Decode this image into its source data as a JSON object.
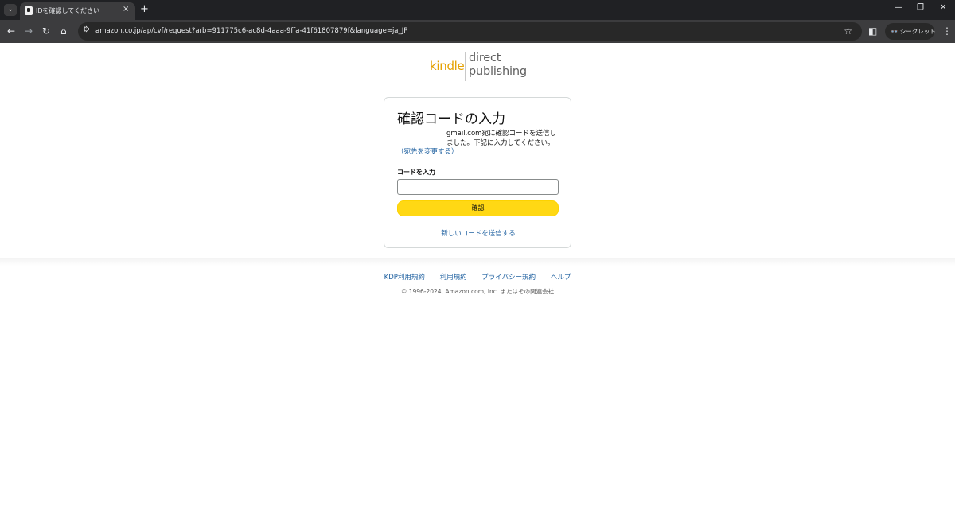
{
  "browser": {
    "tab_title": "IDを確認してください",
    "tab_close": "×",
    "new_tab": "+",
    "url": "amazon.co.jp/ap/cvf/request?arb=911775c6-ac8d-4aaa-9ffa-41f61807879f&language=ja_JP",
    "incognito_label": "シークレット",
    "icons": [
      "back-icon",
      "forward-icon",
      "reload-icon",
      "home-icon",
      "site-info-icon",
      "bookmark-star-icon",
      "side-panel-icon",
      "incognito-icon",
      "menu-icon"
    ]
  },
  "logo": {
    "kindle": "kindle",
    "direct": "direct",
    "publishing": "publishing"
  },
  "verify": {
    "title": "確認コードの入力",
    "desc_email_suffix": "gmail.com宛に確認コードを送信しました。下記に入力してください。",
    "change_link": "（宛先を変更する）",
    "code_label": "コードを入力",
    "code_value": "",
    "confirm_button": "確認",
    "resend_link": "新しいコードを送信する"
  },
  "footer": {
    "links": [
      "KDP利用規約",
      "利用規約",
      "プライバシー規約",
      "ヘルプ"
    ],
    "copyright": "© 1996-2024, Amazon.com, Inc. またはその関連会社"
  },
  "colors": {
    "kindle_orange": "#e5a100",
    "link_blue": "#2162a1",
    "button_yellow": "#ffd814"
  }
}
